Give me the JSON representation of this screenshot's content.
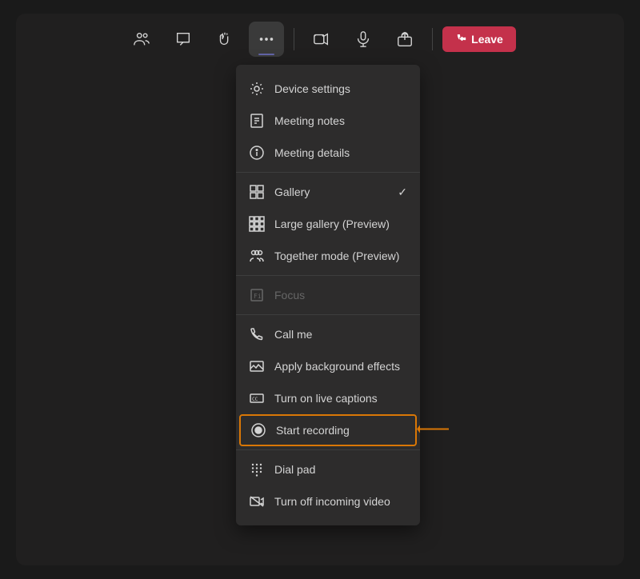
{
  "toolbar": {
    "buttons": [
      {
        "id": "people",
        "label": "People",
        "icon": "people"
      },
      {
        "id": "chat",
        "label": "Chat",
        "icon": "chat"
      },
      {
        "id": "raise-hand",
        "label": "Raise hand",
        "icon": "hand"
      },
      {
        "id": "more",
        "label": "More actions",
        "icon": "more",
        "active": true
      },
      {
        "id": "video",
        "label": "Video",
        "icon": "video"
      },
      {
        "id": "mic",
        "label": "Microphone",
        "icon": "mic"
      },
      {
        "id": "share",
        "label": "Share",
        "icon": "share"
      }
    ],
    "leave_label": "Leave"
  },
  "dropdown": {
    "sections": [
      {
        "id": "settings-section",
        "items": [
          {
            "id": "device-settings",
            "label": "Device settings",
            "icon": "gear",
            "disabled": false
          },
          {
            "id": "meeting-notes",
            "label": "Meeting notes",
            "icon": "notes",
            "disabled": false
          },
          {
            "id": "meeting-details",
            "label": "Meeting details",
            "icon": "info",
            "disabled": false
          }
        ]
      },
      {
        "id": "view-section",
        "items": [
          {
            "id": "gallery",
            "label": "Gallery",
            "icon": "gallery",
            "checked": true,
            "disabled": false
          },
          {
            "id": "large-gallery",
            "label": "Large gallery (Preview)",
            "icon": "large-gallery",
            "disabled": false
          },
          {
            "id": "together-mode",
            "label": "Together mode (Preview)",
            "icon": "together",
            "disabled": false
          }
        ]
      },
      {
        "id": "focus-section",
        "items": [
          {
            "id": "focus",
            "label": "Focus",
            "icon": "focus",
            "disabled": true
          }
        ]
      },
      {
        "id": "actions-section",
        "items": [
          {
            "id": "call-me",
            "label": "Call me",
            "icon": "call",
            "disabled": false
          },
          {
            "id": "background-effects",
            "label": "Apply background effects",
            "icon": "background",
            "disabled": false
          },
          {
            "id": "live-captions",
            "label": "Turn on live captions",
            "icon": "captions",
            "disabled": false
          },
          {
            "id": "start-recording",
            "label": "Start recording",
            "icon": "record",
            "disabled": false,
            "highlighted": true
          }
        ]
      },
      {
        "id": "more-section",
        "items": [
          {
            "id": "dial-pad",
            "label": "Dial pad",
            "icon": "dialpad",
            "disabled": false
          },
          {
            "id": "turn-off-video",
            "label": "Turn off incoming video",
            "icon": "no-video",
            "disabled": false
          }
        ]
      }
    ]
  },
  "annotation": {
    "arrow_color": "#d97706"
  }
}
